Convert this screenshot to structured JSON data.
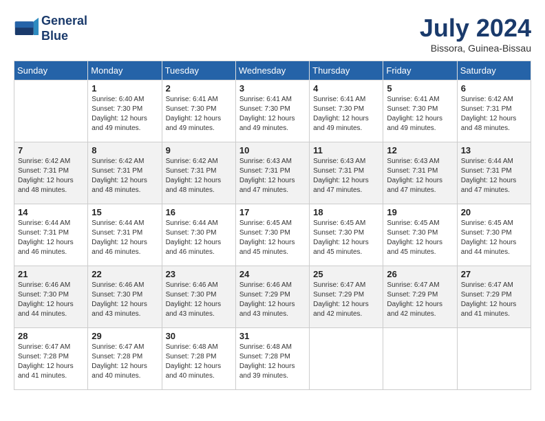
{
  "header": {
    "logo_line1": "General",
    "logo_line2": "Blue",
    "month_year": "July 2024",
    "location": "Bissora, Guinea-Bissau"
  },
  "weekdays": [
    "Sunday",
    "Monday",
    "Tuesday",
    "Wednesday",
    "Thursday",
    "Friday",
    "Saturday"
  ],
  "weeks": [
    [
      {
        "day": "",
        "sunrise": "",
        "sunset": "",
        "daylight": ""
      },
      {
        "day": "1",
        "sunrise": "Sunrise: 6:40 AM",
        "sunset": "Sunset: 7:30 PM",
        "daylight": "Daylight: 12 hours and 49 minutes."
      },
      {
        "day": "2",
        "sunrise": "Sunrise: 6:41 AM",
        "sunset": "Sunset: 7:30 PM",
        "daylight": "Daylight: 12 hours and 49 minutes."
      },
      {
        "day": "3",
        "sunrise": "Sunrise: 6:41 AM",
        "sunset": "Sunset: 7:30 PM",
        "daylight": "Daylight: 12 hours and 49 minutes."
      },
      {
        "day": "4",
        "sunrise": "Sunrise: 6:41 AM",
        "sunset": "Sunset: 7:30 PM",
        "daylight": "Daylight: 12 hours and 49 minutes."
      },
      {
        "day": "5",
        "sunrise": "Sunrise: 6:41 AM",
        "sunset": "Sunset: 7:30 PM",
        "daylight": "Daylight: 12 hours and 49 minutes."
      },
      {
        "day": "6",
        "sunrise": "Sunrise: 6:42 AM",
        "sunset": "Sunset: 7:31 PM",
        "daylight": "Daylight: 12 hours and 48 minutes."
      }
    ],
    [
      {
        "day": "7",
        "sunrise": "Sunrise: 6:42 AM",
        "sunset": "Sunset: 7:31 PM",
        "daylight": "Daylight: 12 hours and 48 minutes."
      },
      {
        "day": "8",
        "sunrise": "Sunrise: 6:42 AM",
        "sunset": "Sunset: 7:31 PM",
        "daylight": "Daylight: 12 hours and 48 minutes."
      },
      {
        "day": "9",
        "sunrise": "Sunrise: 6:42 AM",
        "sunset": "Sunset: 7:31 PM",
        "daylight": "Daylight: 12 hours and 48 minutes."
      },
      {
        "day": "10",
        "sunrise": "Sunrise: 6:43 AM",
        "sunset": "Sunset: 7:31 PM",
        "daylight": "Daylight: 12 hours and 47 minutes."
      },
      {
        "day": "11",
        "sunrise": "Sunrise: 6:43 AM",
        "sunset": "Sunset: 7:31 PM",
        "daylight": "Daylight: 12 hours and 47 minutes."
      },
      {
        "day": "12",
        "sunrise": "Sunrise: 6:43 AM",
        "sunset": "Sunset: 7:31 PM",
        "daylight": "Daylight: 12 hours and 47 minutes."
      },
      {
        "day": "13",
        "sunrise": "Sunrise: 6:44 AM",
        "sunset": "Sunset: 7:31 PM",
        "daylight": "Daylight: 12 hours and 47 minutes."
      }
    ],
    [
      {
        "day": "14",
        "sunrise": "Sunrise: 6:44 AM",
        "sunset": "Sunset: 7:31 PM",
        "daylight": "Daylight: 12 hours and 46 minutes."
      },
      {
        "day": "15",
        "sunrise": "Sunrise: 6:44 AM",
        "sunset": "Sunset: 7:31 PM",
        "daylight": "Daylight: 12 hours and 46 minutes."
      },
      {
        "day": "16",
        "sunrise": "Sunrise: 6:44 AM",
        "sunset": "Sunset: 7:30 PM",
        "daylight": "Daylight: 12 hours and 46 minutes."
      },
      {
        "day": "17",
        "sunrise": "Sunrise: 6:45 AM",
        "sunset": "Sunset: 7:30 PM",
        "daylight": "Daylight: 12 hours and 45 minutes."
      },
      {
        "day": "18",
        "sunrise": "Sunrise: 6:45 AM",
        "sunset": "Sunset: 7:30 PM",
        "daylight": "Daylight: 12 hours and 45 minutes."
      },
      {
        "day": "19",
        "sunrise": "Sunrise: 6:45 AM",
        "sunset": "Sunset: 7:30 PM",
        "daylight": "Daylight: 12 hours and 45 minutes."
      },
      {
        "day": "20",
        "sunrise": "Sunrise: 6:45 AM",
        "sunset": "Sunset: 7:30 PM",
        "daylight": "Daylight: 12 hours and 44 minutes."
      }
    ],
    [
      {
        "day": "21",
        "sunrise": "Sunrise: 6:46 AM",
        "sunset": "Sunset: 7:30 PM",
        "daylight": "Daylight: 12 hours and 44 minutes."
      },
      {
        "day": "22",
        "sunrise": "Sunrise: 6:46 AM",
        "sunset": "Sunset: 7:30 PM",
        "daylight": "Daylight: 12 hours and 43 minutes."
      },
      {
        "day": "23",
        "sunrise": "Sunrise: 6:46 AM",
        "sunset": "Sunset: 7:30 PM",
        "daylight": "Daylight: 12 hours and 43 minutes."
      },
      {
        "day": "24",
        "sunrise": "Sunrise: 6:46 AM",
        "sunset": "Sunset: 7:29 PM",
        "daylight": "Daylight: 12 hours and 43 minutes."
      },
      {
        "day": "25",
        "sunrise": "Sunrise: 6:47 AM",
        "sunset": "Sunset: 7:29 PM",
        "daylight": "Daylight: 12 hours and 42 minutes."
      },
      {
        "day": "26",
        "sunrise": "Sunrise: 6:47 AM",
        "sunset": "Sunset: 7:29 PM",
        "daylight": "Daylight: 12 hours and 42 minutes."
      },
      {
        "day": "27",
        "sunrise": "Sunrise: 6:47 AM",
        "sunset": "Sunset: 7:29 PM",
        "daylight": "Daylight: 12 hours and 41 minutes."
      }
    ],
    [
      {
        "day": "28",
        "sunrise": "Sunrise: 6:47 AM",
        "sunset": "Sunset: 7:28 PM",
        "daylight": "Daylight: 12 hours and 41 minutes."
      },
      {
        "day": "29",
        "sunrise": "Sunrise: 6:47 AM",
        "sunset": "Sunset: 7:28 PM",
        "daylight": "Daylight: 12 hours and 40 minutes."
      },
      {
        "day": "30",
        "sunrise": "Sunrise: 6:48 AM",
        "sunset": "Sunset: 7:28 PM",
        "daylight": "Daylight: 12 hours and 40 minutes."
      },
      {
        "day": "31",
        "sunrise": "Sunrise: 6:48 AM",
        "sunset": "Sunset: 7:28 PM",
        "daylight": "Daylight: 12 hours and 39 minutes."
      },
      {
        "day": "",
        "sunrise": "",
        "sunset": "",
        "daylight": ""
      },
      {
        "day": "",
        "sunrise": "",
        "sunset": "",
        "daylight": ""
      },
      {
        "day": "",
        "sunrise": "",
        "sunset": "",
        "daylight": ""
      }
    ]
  ]
}
